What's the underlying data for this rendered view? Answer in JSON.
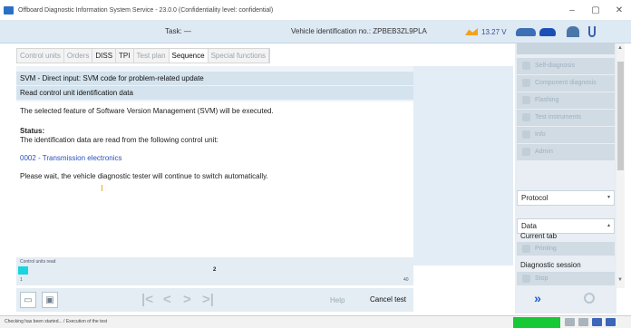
{
  "window": {
    "title": "Offboard Diagnostic Information System Service - 23.0.0 (Confidentiality level: confidential)",
    "minimize": "–",
    "maximize": "▢",
    "close": "✕"
  },
  "toolbar": {
    "task": "Task:  —",
    "vin_label": "Vehicle identification no.:  ZPBEB3ZL9PLA",
    "voltage": "13.27 V"
  },
  "tabs": [
    "Control units",
    "Orders",
    "DISS",
    "TPI",
    "Test plan",
    "Sequence",
    "Special functions"
  ],
  "active_tab": "Sequence",
  "main": {
    "heading1": "SVM - Direct input: SVM code for problem-related update",
    "heading2": "Read control unit identification data",
    "line1": "The selected feature of Software Version Management (SVM) will be executed.",
    "status_label": "Status:",
    "status_text": "The identification data are read from the following control unit:",
    "control_unit": "0002 - Transmission electronics",
    "wait_text": "Please wait, the vehicle diagnostic tester will continue to switch automatically.",
    "cursor_glyph": "I"
  },
  "progress": {
    "label": "Control units read",
    "value": 1,
    "max": 40,
    "center_text": "2",
    "min_text": "1",
    "max_text": "40"
  },
  "nav": {
    "first": "|<",
    "prev": "<",
    "next": ">",
    "last": ">|",
    "help": "Help",
    "cancel": "Cancel test"
  },
  "sidebar": {
    "modes": [
      "Self-diagnosis",
      "Component diagnosis",
      "Flashing",
      "Test instruments",
      "Info",
      "Admin"
    ],
    "protocol": "Protocol",
    "data": "Data",
    "current_tab": "Current tab",
    "printing": "Printing",
    "diagnostic_session": "Diagnostic session",
    "stop": "Stop",
    "forward": "»"
  },
  "statusbar": {
    "text": "Checking has been started... / Execution of the test"
  },
  "colors": {
    "accent_blue": "#2a4fc0",
    "progress_cyan": "#19d5e0",
    "status_green": "#17c934",
    "panel_blue": "#d4e3ee"
  }
}
